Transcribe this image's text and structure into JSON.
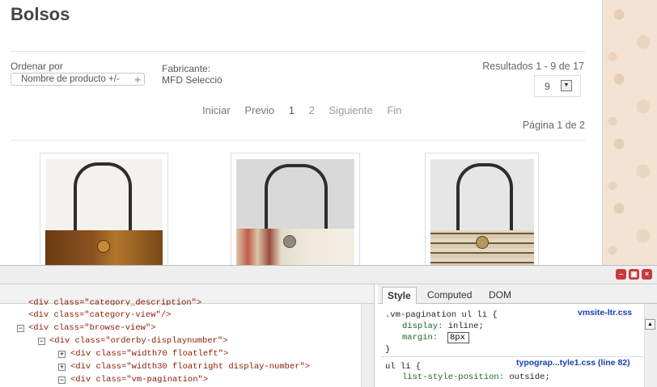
{
  "page": {
    "title": "Bolsos",
    "order_label": "Ordenar por",
    "order_select": "Nombre de producto +/-",
    "manufacturer_label": "Fabricante:",
    "manufacturer_value": "MFD Selecció",
    "results": "Resultados 1 - 9 de 17",
    "per_page_value": "9",
    "pagination": [
      "Iniciar",
      "Previo",
      "1",
      "2",
      "Siguiente",
      "Fin"
    ],
    "page_info": "Página 1 de 2"
  },
  "devtools": {
    "tabs": [
      "Style",
      "Computed",
      "DOM"
    ],
    "active_tab": "Style",
    "tree": [
      {
        "indent": 0,
        "toggle": "",
        "text": "<div class=\"category_description\">",
        "partial": true
      },
      {
        "indent": 0,
        "toggle": "",
        "text": "<div class=\"category-view\"/>"
      },
      {
        "indent": 0,
        "toggle": "−",
        "text": "<div class=\"browse-view\">"
      },
      {
        "indent": 1,
        "toggle": "−",
        "text": "<div class=\"orderby-displaynumber\">"
      },
      {
        "indent": 2,
        "toggle": "+",
        "text": "<div class=\"width70 floatleft\">"
      },
      {
        "indent": 2,
        "toggle": "+",
        "text": "<div class=\"width30 floatright display-number\">"
      },
      {
        "indent": 2,
        "toggle": "−",
        "text": "<div class=\"vm-pagination\">"
      }
    ],
    "rules": {
      "r1_selector": ".vm-pagination ul li {",
      "r1_source": "vmsite-ltr.css",
      "r1_p1_name": "display:",
      "r1_p1_value": "inline;",
      "r1_p2_name": "margin:",
      "r1_p2_value": "8px",
      "r1_close": "}",
      "r2_selector": "ul li {",
      "r2_source": "typograp...tyle1.css (line 82)",
      "r2_p1_name": "list-style-position:",
      "r2_p1_value": "outside;"
    }
  },
  "colors": {
    "close": "#c9393b",
    "floral": "#f3e3d3"
  }
}
